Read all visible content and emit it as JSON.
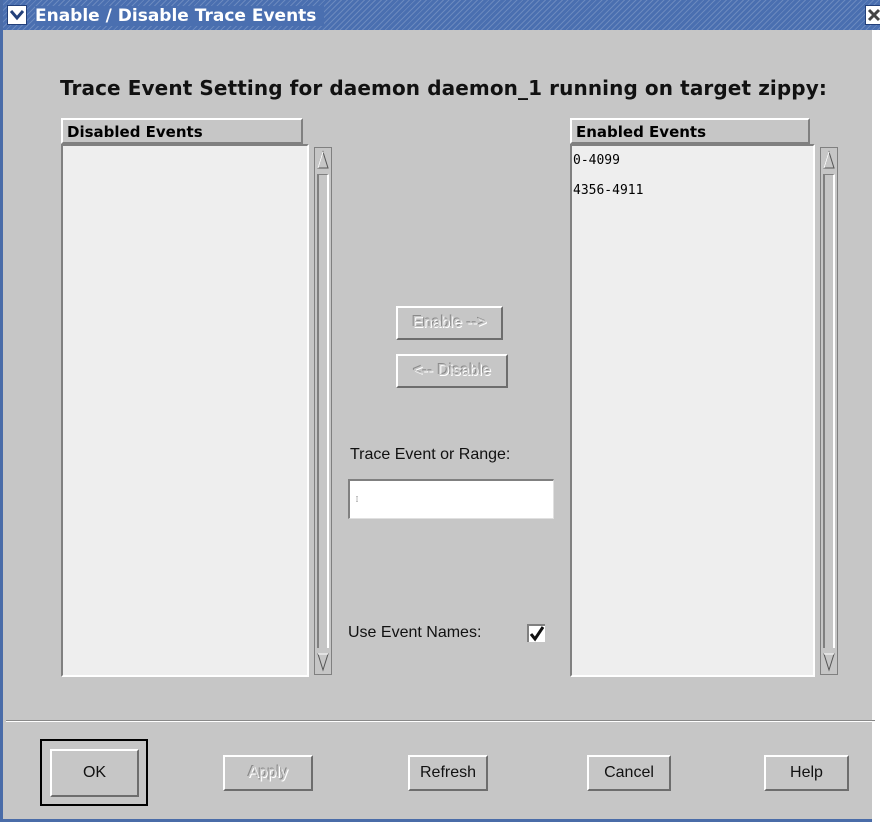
{
  "window": {
    "title": "Enable / Disable Trace Events"
  },
  "heading": "Trace Event Setting for daemon daemon_1 running on target zippy:",
  "disabled_list": {
    "header": "Disabled Events",
    "items": []
  },
  "enabled_list": {
    "header": "Enabled Events",
    "items": [
      "0-4099",
      "4356-4911"
    ]
  },
  "buttons": {
    "enable": "Enable -->",
    "disable": "<-- Disable",
    "ok": "OK",
    "apply": "Apply",
    "refresh": "Refresh",
    "cancel": "Cancel",
    "help": "Help"
  },
  "range": {
    "label": "Trace Event or Range:",
    "value": ""
  },
  "use_event_names": {
    "label": "Use Event Names:",
    "checked": true
  },
  "icons": {
    "menu": "chevron-down-icon",
    "close": "close-icon"
  },
  "colors": {
    "title_bar": "#4a6fb0",
    "window_bg": "#c6c6c6",
    "list_bg": "#eeeeee"
  }
}
